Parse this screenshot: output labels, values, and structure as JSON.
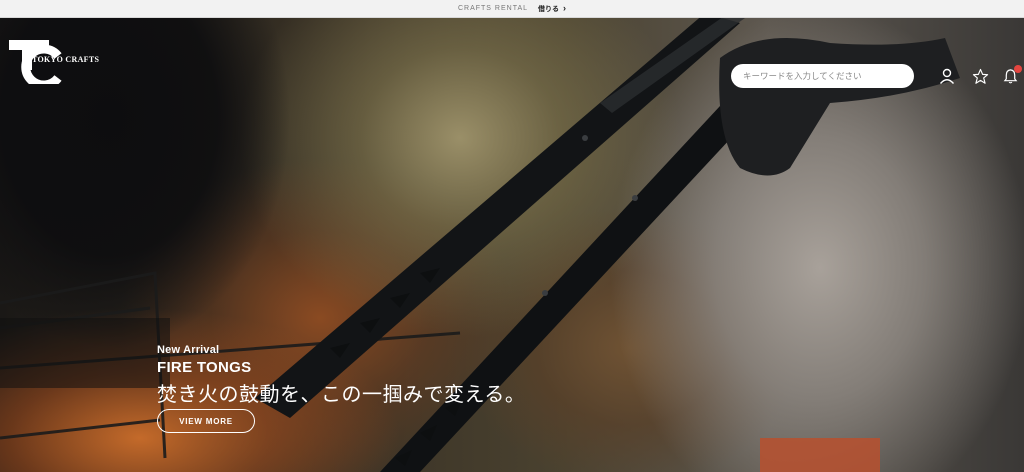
{
  "topbar": {
    "rental_label": "CRAFTS RENTAL",
    "rent_link": "借りる",
    "rent_chevron": "›"
  },
  "header": {
    "logo_text": "TOKYO CRAFTS",
    "search": {
      "placeholder": "キーワードを入力してください",
      "value": ""
    },
    "icons": [
      "user-icon",
      "star-icon",
      "bell-icon"
    ],
    "notification_badge_color": "#e4453f"
  },
  "hero": {
    "eyebrow": "New Arrival",
    "title": "FIRE TONGS",
    "tagline": "焚き火の鼓動を、この一掴みで変える。",
    "cta_label": "VIEW MORE"
  },
  "slider": {
    "thumbnails": [
      {
        "color": "#5b6e7a",
        "active": false
      },
      {
        "color": "#3f6b2e",
        "active": false
      },
      {
        "color": "#d9d2c8",
        "active": true
      },
      {
        "color": "#4a4f58",
        "active": false
      },
      {
        "color": "#8c8f95",
        "active": false
      }
    ]
  },
  "colors": {
    "topbar_bg": "#f2f2f2",
    "text_on_hero": "#ffffff",
    "accent_badge": "#e4453f"
  }
}
